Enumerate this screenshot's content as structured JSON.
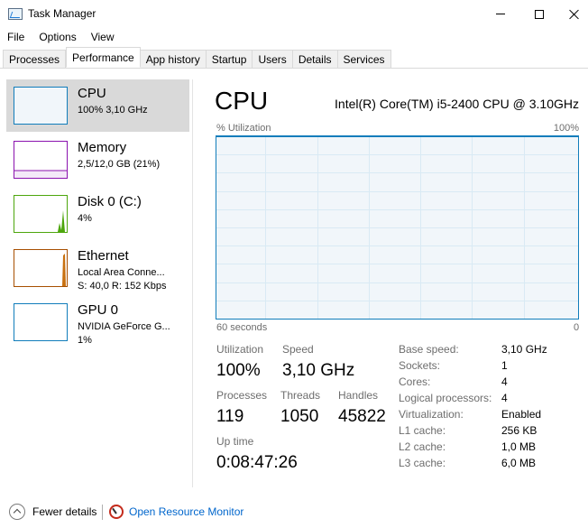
{
  "window": {
    "title": "Task Manager"
  },
  "menu": [
    "File",
    "Options",
    "View"
  ],
  "tabs": [
    {
      "label": "Processes",
      "active": false
    },
    {
      "label": "Performance",
      "active": true
    },
    {
      "label": "App history",
      "active": false
    },
    {
      "label": "Startup",
      "active": false
    },
    {
      "label": "Users",
      "active": false
    },
    {
      "label": "Details",
      "active": false
    },
    {
      "label": "Services",
      "active": false
    }
  ],
  "sidebar": {
    "items": [
      {
        "name": "CPU",
        "line1": "100%  3,10 GHz",
        "line2": "",
        "color": "#117dbb",
        "selected": true
      },
      {
        "name": "Memory",
        "line1": "2,5/12,0 GB (21%)",
        "line2": "",
        "color": "#8b12ae",
        "selected": false
      },
      {
        "name": "Disk 0 (C:)",
        "line1": "4%",
        "line2": "",
        "color": "#4da60c",
        "selected": false
      },
      {
        "name": "Ethernet",
        "line1": "Local Area Conne...",
        "line2": "S: 40,0  R: 152 Kbps",
        "color": "#a74f01",
        "selected": false
      },
      {
        "name": "GPU 0",
        "line1": "NVIDIA GeForce G...",
        "line2": "1%",
        "color": "#117dbb",
        "selected": false
      }
    ]
  },
  "main": {
    "title": "CPU",
    "model": "Intel(R) Core(TM) i5-2400 CPU @ 3.10GHz",
    "graph": {
      "y_label": "% Utilization",
      "y_max_label": "100%",
      "x_left_label": "60 seconds",
      "x_right_label": "0",
      "utilization_percent": 100,
      "line_color": "#117dbb",
      "fill_color": "#f1f6fa"
    },
    "stats": {
      "utilization_label": "Utilization",
      "utilization_value": "100%",
      "speed_label": "Speed",
      "speed_value": "3,10 GHz",
      "processes_label": "Processes",
      "processes_value": "119",
      "threads_label": "Threads",
      "threads_value": "1050",
      "handles_label": "Handles",
      "handles_value": "45822",
      "uptime_label": "Up time",
      "uptime_value": "0:08:47:26"
    },
    "specs": [
      {
        "label": "Base speed:",
        "value": "3,10 GHz"
      },
      {
        "label": "Sockets:",
        "value": "1"
      },
      {
        "label": "Cores:",
        "value": "4"
      },
      {
        "label": "Logical processors:",
        "value": "4"
      },
      {
        "label": "Virtualization:",
        "value": "Enabled"
      },
      {
        "label": "L1 cache:",
        "value": "256 KB"
      },
      {
        "label": "L2 cache:",
        "value": "1,0 MB"
      },
      {
        "label": "L3 cache:",
        "value": "6,0 MB"
      }
    ]
  },
  "footer": {
    "fewer_details": "Fewer details",
    "open_resource_monitor": "Open Resource Monitor"
  }
}
